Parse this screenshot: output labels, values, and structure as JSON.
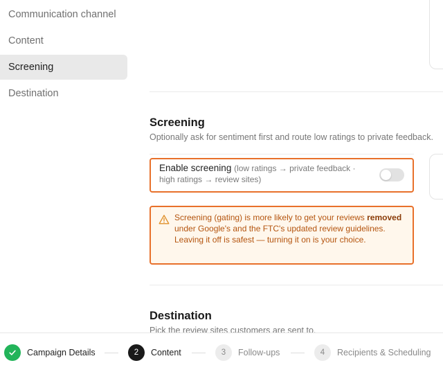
{
  "sidebar": {
    "items": [
      {
        "label": "Communication channel",
        "active": false
      },
      {
        "label": "Content",
        "active": false
      },
      {
        "label": "Screening",
        "active": true
      },
      {
        "label": "Destination",
        "active": false
      }
    ]
  },
  "screening": {
    "title": "Screening",
    "subtitle": "Optionally ask for sentiment first and route low ratings to private feedback.",
    "toggle": {
      "label": "Enable screening",
      "hint_part1": "(low ratings → private feedback ·",
      "hint_part2": "high ratings → review sites)",
      "enabled": false
    },
    "warning": {
      "icon": "warning-triangle-icon",
      "text_before": "Screening (gating) is more likely to get your reviews ",
      "text_bold": "removed",
      "text_after": " under Google's and the FTC's updated review guidelines. Leaving it off is safest — turning it on is your choice."
    }
  },
  "destination": {
    "title": "Destination",
    "subtitle": "Pick the review sites customers are sent to."
  },
  "stepper": {
    "steps": [
      {
        "number": "",
        "label": "Campaign Details",
        "state": "done",
        "icon": "check-icon"
      },
      {
        "number": "2",
        "label": "Content",
        "state": "current"
      },
      {
        "number": "3",
        "label": "Follow-ups",
        "state": "todo"
      },
      {
        "number": "4",
        "label": "Recipients & Scheduling",
        "state": "todo"
      }
    ]
  },
  "colors": {
    "accent_outline": "#e8702a",
    "warning_bg": "#fff7ec",
    "warning_text": "#b4540e",
    "done_green": "#22b45a",
    "current_dark": "#1a1a1a"
  }
}
